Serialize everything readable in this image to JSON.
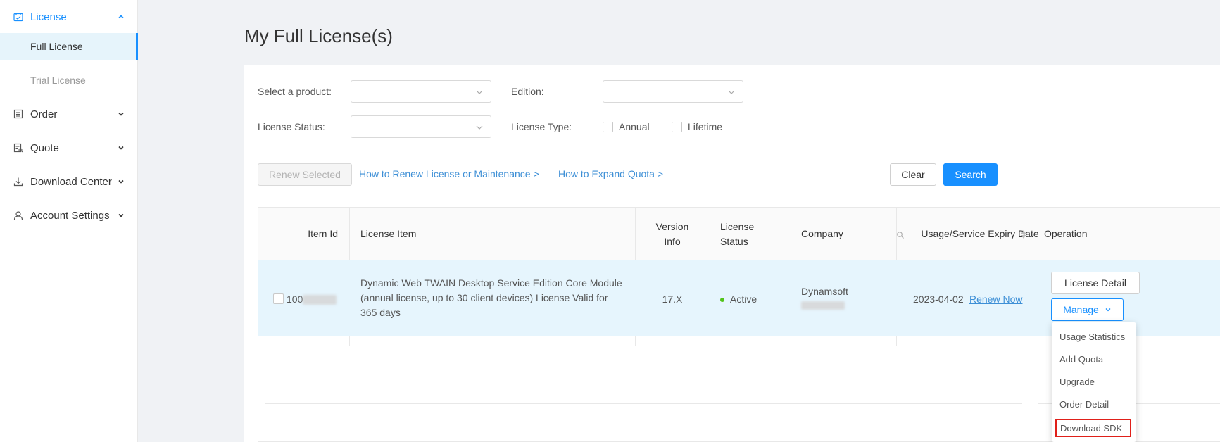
{
  "sidebar": {
    "items": [
      {
        "label": "License",
        "icon": "license-icon",
        "expanded": true,
        "children": [
          {
            "label": "Full License",
            "selected": true
          },
          {
            "label": "Trial License",
            "selected": false
          }
        ]
      },
      {
        "label": "Order",
        "icon": "order-icon"
      },
      {
        "label": "Quote",
        "icon": "quote-icon"
      },
      {
        "label": "Download Center",
        "icon": "download-icon"
      },
      {
        "label": "Account Settings",
        "icon": "user-icon"
      }
    ]
  },
  "page": {
    "title": "My Full License(s)"
  },
  "filters": {
    "product_label": "Select a product:",
    "edition_label": "Edition:",
    "status_label": "License Status:",
    "type_label": "License Type:",
    "type_options": [
      "Annual",
      "Lifetime"
    ]
  },
  "actions": {
    "renew_selected": "Renew Selected",
    "link_renew": "How to Renew License or Maintenance >",
    "link_expand": "How to Expand Quota >",
    "clear": "Clear",
    "search": "Search"
  },
  "table": {
    "headers": [
      "Item Id",
      "License Item",
      "Version Info",
      "License Status",
      "Company",
      "Usage/Service Expiry Date",
      "Operation"
    ],
    "rows": [
      {
        "item_id_prefix": "100",
        "license_item": "Dynamic Web TWAIN Desktop Service Edition Core Module (annual license, up to 30 client devices) License Valid for 365 days",
        "version": "17.X",
        "status": "Active",
        "company_prefix": "Dynamsoft",
        "expiry_date": "2023-04-02",
        "renew_link": "Renew Now",
        "detail_button": "License Detail",
        "manage_button": "Manage"
      }
    ]
  },
  "manage_menu": {
    "items": [
      "Usage Statistics",
      "Add Quota",
      "Upgrade",
      "Order Detail",
      "Download SDK"
    ],
    "highlighted": "Download SDK"
  },
  "colors": {
    "accent": "#1890ff",
    "active_status": "#52c41a",
    "highlight_border": "#e0201a",
    "selected_row": "#e6f5fd"
  }
}
